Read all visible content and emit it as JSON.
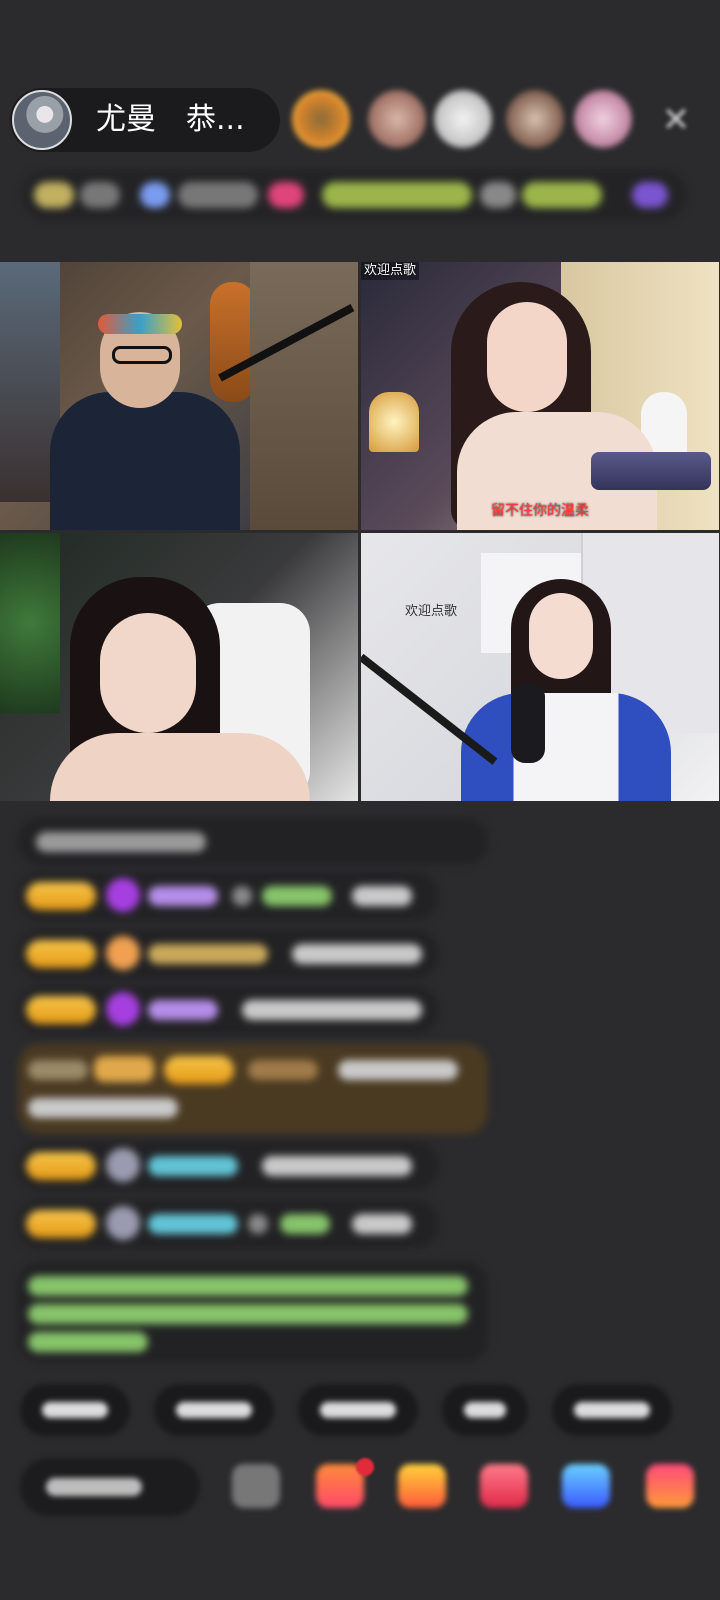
{
  "header": {
    "host_name": "尤曼　恭...",
    "close_icon": "close-icon"
  },
  "video_tiles": [
    {
      "caption": ""
    },
    {
      "caption_top": "欢迎点歌",
      "caption_bottom": "留不住你的温柔"
    },
    {
      "caption": ""
    },
    {
      "caption_top": "欢迎点歌"
    }
  ],
  "colors": {
    "background": "#2b2b2d",
    "badge_gold": "#f5c44a",
    "chat_green": "#9be07a",
    "chat_blue": "#61c3d6",
    "chat_purple": "#b48de8"
  },
  "icons": {
    "gem": "diamond-icon",
    "chat": "chat-bubble-icon",
    "gift": "gift-icon"
  }
}
